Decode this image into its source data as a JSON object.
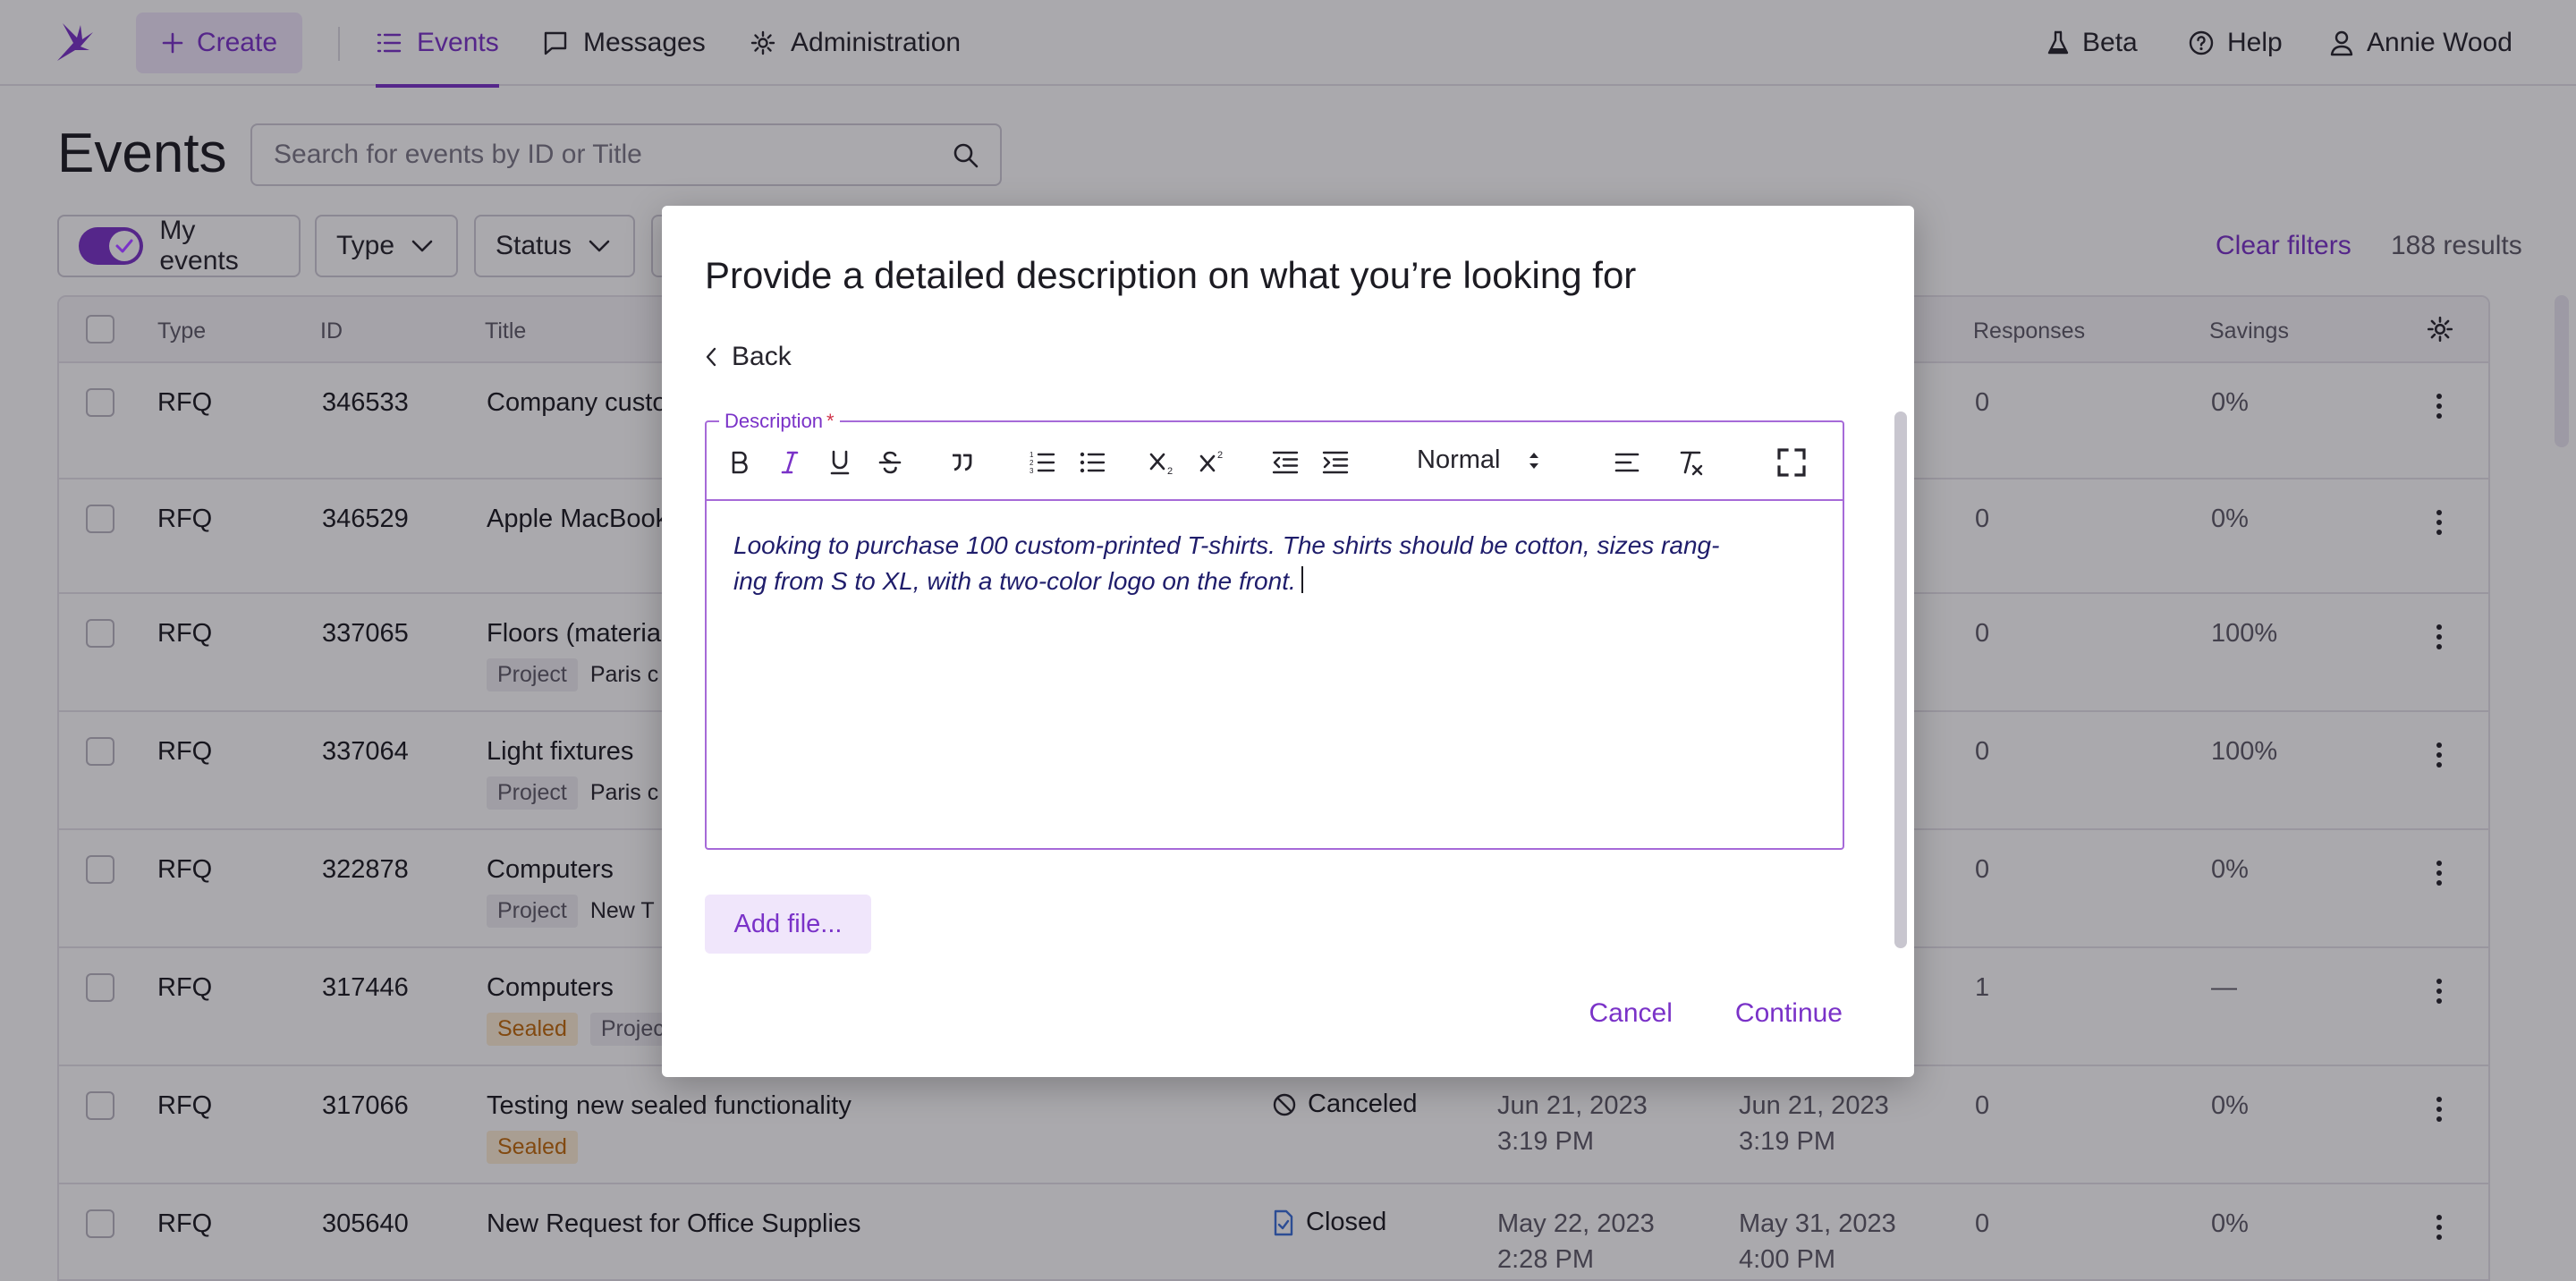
{
  "nav": {
    "create_label": "Create",
    "items": [
      {
        "label": "Events",
        "icon": "list-icon",
        "active": true
      },
      {
        "label": "Messages",
        "icon": "message-icon",
        "active": false
      },
      {
        "label": "Administration",
        "icon": "gear-icon",
        "active": false
      }
    ],
    "beta_label": "Beta",
    "help_label": "Help",
    "user_name": "Annie Wood"
  },
  "page": {
    "title": "Events",
    "search_placeholder": "Search for events by ID or Title",
    "filters": {
      "my_events_label": "My events",
      "my_events_on": true,
      "type_label": "Type",
      "status_label": "Status"
    },
    "clear_filters_label": "Clear filters",
    "results_text": "188 results"
  },
  "table": {
    "columns": {
      "type": "Type",
      "id": "ID",
      "title": "Title",
      "responses": "Responses",
      "savings": "Savings"
    },
    "rows": [
      {
        "type": "RFQ",
        "id": "346533",
        "title": "Company custo",
        "responses": "0",
        "savings": "0%"
      },
      {
        "type": "RFQ",
        "id": "346529",
        "title": "Apple MacBook",
        "responses": "0",
        "savings": "0%"
      },
      {
        "type": "RFQ",
        "id": "337065",
        "title": "Floors (materia",
        "tags": [
          "Project",
          "Paris c"
        ],
        "responses": "0",
        "savings": "100%"
      },
      {
        "type": "RFQ",
        "id": "337064",
        "title": "Light fixtures",
        "tags": [
          "Project",
          "Paris c"
        ],
        "responses": "0",
        "savings": "100%"
      },
      {
        "type": "RFQ",
        "id": "322878",
        "title": "Computers",
        "tags": [
          "Project",
          "New T"
        ],
        "responses": "0",
        "savings": "0%"
      },
      {
        "type": "RFQ",
        "id": "317446",
        "title": "Computers",
        "tags": [
          "Sealed",
          "Projec"
        ],
        "responses": "1",
        "savings": "—"
      },
      {
        "type": "RFQ",
        "id": "317066",
        "title": "Testing new sealed functionality",
        "tags": [
          "Sealed"
        ],
        "status": "Canceled",
        "start_date": "Jun 21, 2023",
        "start_time": "3:19 PM",
        "end_date": "Jun 21, 2023",
        "end_time": "3:19 PM",
        "responses": "0",
        "savings": "0%"
      },
      {
        "type": "RFQ",
        "id": "305640",
        "title": "New Request for Office Supplies",
        "status": "Closed",
        "start_date": "May 22, 2023",
        "start_time": "2:28 PM",
        "end_date": "May 31, 2023",
        "end_time": "4:00 PM",
        "responses": "0",
        "savings": "0%"
      }
    ]
  },
  "modal": {
    "title": "Provide a detailed description on what you’re looking for",
    "back_label": "Back",
    "field_label": "Description",
    "required_mark": "*",
    "format_value": "Normal",
    "description_line1": "Looking to purchase 100 custom-printed T-shirts. The shirts should be cotton, sizes rang-",
    "description_line2": "ing from S to XL, with a two-color logo on the front.",
    "add_file_label": "Add file...",
    "cancel_label": "Cancel",
    "continue_label": "Continue"
  },
  "colors": {
    "accent": "#7a32c8",
    "accent_soft": "#f0e6fb",
    "sealed_bg": "#fdeed5",
    "sealed_text": "#c06a0a"
  }
}
